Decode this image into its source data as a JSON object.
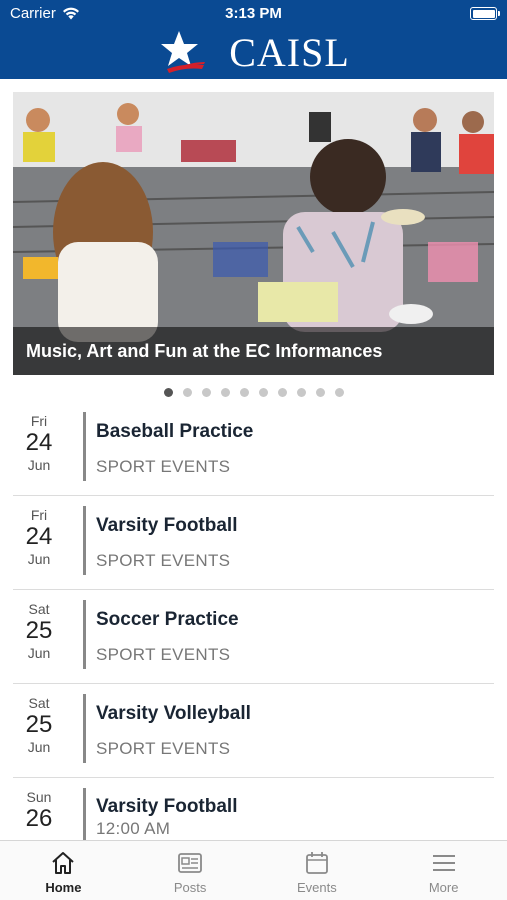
{
  "status_bar": {
    "carrier": "Carrier",
    "time": "3:13 PM"
  },
  "header": {
    "brand": "CAISL",
    "logo_icon": "star-logo-icon"
  },
  "banner": {
    "caption": "Music, Art and Fun at the EC Informances",
    "dot_count": 10,
    "active_dot": 1
  },
  "events": [
    {
      "dow": "Fri",
      "day": "24",
      "month": "Jun",
      "title": "Baseball Practice",
      "subtitle": "SPORT EVENTS"
    },
    {
      "dow": "Fri",
      "day": "24",
      "month": "Jun",
      "title": "Varsity Football",
      "subtitle": "SPORT EVENTS"
    },
    {
      "dow": "Sat",
      "day": "25",
      "month": "Jun",
      "title": "Soccer Practice",
      "subtitle": "SPORT EVENTS"
    },
    {
      "dow": "Sat",
      "day": "25",
      "month": "Jun",
      "title": "Varsity Volleyball",
      "subtitle": "SPORT EVENTS"
    },
    {
      "dow": "Sun",
      "day": "26",
      "month": "",
      "title": "Varsity Football",
      "subtitle": "12:00 AM"
    }
  ],
  "tabs": [
    {
      "label": "Home",
      "icon": "home-icon",
      "active": true
    },
    {
      "label": "Posts",
      "icon": "posts-icon",
      "active": false
    },
    {
      "label": "Events",
      "icon": "calendar-icon",
      "active": false
    },
    {
      "label": "More",
      "icon": "menu-icon",
      "active": false
    }
  ],
  "colors": {
    "header_bg": "#0a4a93",
    "logo_accent": "#d4202a"
  }
}
